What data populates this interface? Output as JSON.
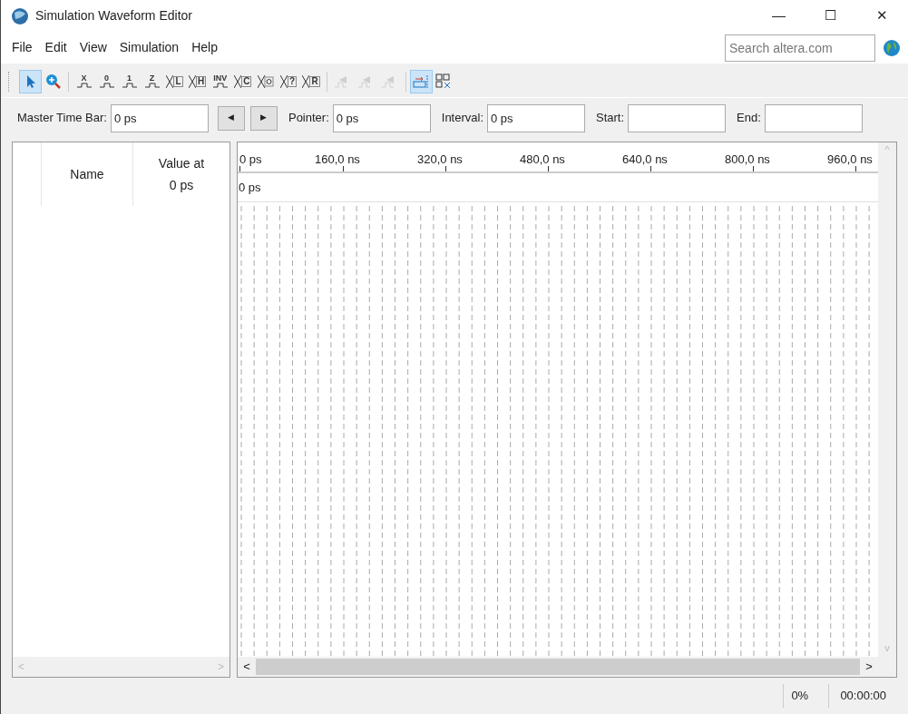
{
  "window": {
    "title": "Simulation Waveform Editor",
    "controls": [
      "—",
      "☐",
      "✕"
    ]
  },
  "menu": [
    "File",
    "Edit",
    "View",
    "Simulation",
    "Help"
  ],
  "search": {
    "placeholder": "Search altera.com"
  },
  "toolbar": [
    {
      "kind": "pointer",
      "selected": true,
      "disabled": false
    },
    {
      "kind": "zoom",
      "selected": false,
      "disabled": false
    },
    {
      "kind": "separator"
    },
    {
      "kind": "value",
      "glyph": "X",
      "selected": false,
      "disabled": false
    },
    {
      "kind": "value",
      "glyph": "0",
      "selected": false,
      "disabled": false
    },
    {
      "kind": "value",
      "glyph": "1",
      "selected": false,
      "disabled": false
    },
    {
      "kind": "value",
      "glyph": "Z",
      "selected": false,
      "disabled": false
    },
    {
      "kind": "bus",
      "glyph": "L",
      "selected": false,
      "disabled": false
    },
    {
      "kind": "bus",
      "glyph": "H",
      "selected": false,
      "disabled": false
    },
    {
      "kind": "value",
      "glyph": "INV",
      "selected": false,
      "disabled": false
    },
    {
      "kind": "bus",
      "glyph": "C",
      "selected": false,
      "disabled": false
    },
    {
      "kind": "count",
      "selected": false,
      "disabled": false
    },
    {
      "kind": "bus",
      "glyph": "?",
      "selected": false,
      "disabled": false
    },
    {
      "kind": "bus",
      "glyph": "R",
      "selected": false,
      "disabled": false
    },
    {
      "kind": "separator"
    },
    {
      "kind": "wave",
      "selected": false,
      "disabled": true
    },
    {
      "kind": "wave",
      "selected": false,
      "disabled": true
    },
    {
      "kind": "wave",
      "selected": false,
      "disabled": true
    },
    {
      "kind": "separator"
    },
    {
      "kind": "snap",
      "selected": true,
      "disabled": false
    },
    {
      "kind": "grid",
      "selected": false,
      "disabled": false
    }
  ],
  "time_bar": [
    {
      "label": "Master Time Bar:",
      "value": "0 ps"
    },
    {
      "kind": "prev",
      "glyph": "◀"
    },
    {
      "kind": "next",
      "glyph": "▶"
    },
    {
      "label": "Pointer:",
      "value": "0 ps"
    },
    {
      "label": "Interval:",
      "value": "0 ps"
    },
    {
      "label": "Start:"
    },
    {
      "label": "End:"
    }
  ],
  "signal_table": {
    "columns": [
      "Name",
      "Value at\n0 ps"
    ],
    "scroll_left": "<",
    "scroll_right": ">"
  },
  "waveform": {
    "ruler": [
      "0 ps",
      "160,0 ns",
      "320,0 ns",
      "480,0 ns",
      "640,0 ns",
      "800,0 ns",
      "960,0 ns"
    ],
    "cursor_label": "0 ps",
    "scroll_left": "<",
    "scroll_right": ">",
    "scroll_up": "^",
    "scroll_down": "v"
  },
  "status_bar": {
    "progress": "0%",
    "elapsed": "00:00:00"
  }
}
